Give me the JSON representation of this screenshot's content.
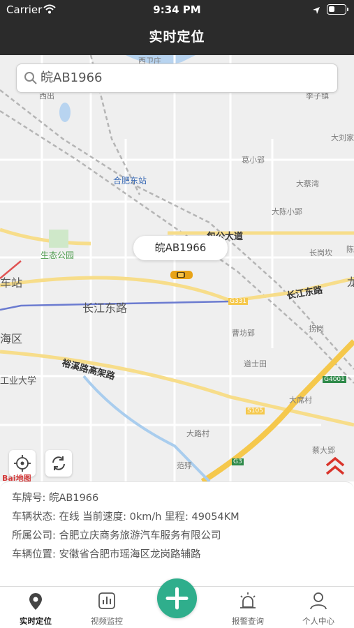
{
  "status_bar": {
    "carrier": "Carrier",
    "time": "9:34 PM"
  },
  "header": {
    "title": "实时定位"
  },
  "search": {
    "value": "皖AB1966"
  },
  "map": {
    "marker_label": "皖AB1966",
    "labels": {
      "xiweizhuang": "西卫庄",
      "xichu": "西出",
      "lizizhen": "李子镇",
      "hefei_east": "合肥东站",
      "gexiaoying": "葛小郢",
      "daliu": "大刘家",
      "dacaiwan": "大蔡湾",
      "dachen": "大陈小郢",
      "baogong": "包公大道",
      "eco_park": "生态公园",
      "changgangkan": "长岗坎",
      "chen": "陈",
      "zhan": "车站",
      "changjiang_e": "长江东路",
      "changjiang_e2": "长江东路",
      "road_code_1": "G331",
      "long": "龙",
      "caofang": "曹坊郢",
      "haiqu": "海区",
      "yuxi": "裕溪路高架路",
      "daoshitian": "道士田",
      "luogang": "拐岗",
      "g4001": "G4001",
      "gongye": "工业大学",
      "daxicun": "大席村",
      "s105": "S105",
      "dalu": "大路村",
      "caidaying": "蔡大郢",
      "g3": "G3",
      "fanyao": "范殍",
      "baidu": "Bai地图"
    }
  },
  "vehicle": {
    "plate": "车牌号: 皖AB1966",
    "status_line": "车辆状态: 在线   当前速度: 0km/h   里程: 49054KM",
    "company": "所属公司: 合肥立庆商务旅游汽车服务有限公司",
    "location": "车辆位置: 安徽省合肥市瑶海区龙岗路辅路"
  },
  "tabs": [
    {
      "label": "实时定位",
      "icon": "location-pin-icon"
    },
    {
      "label": "视频监控",
      "icon": "chart-icon"
    },
    {
      "label": "报警查询",
      "icon": "alarm-siren-icon"
    },
    {
      "label": "个人中心",
      "icon": "person-icon"
    }
  ],
  "colors": {
    "header_bg": "#2b2b2b",
    "accent": "#2fae8c",
    "expressway": "#f5c84c"
  }
}
